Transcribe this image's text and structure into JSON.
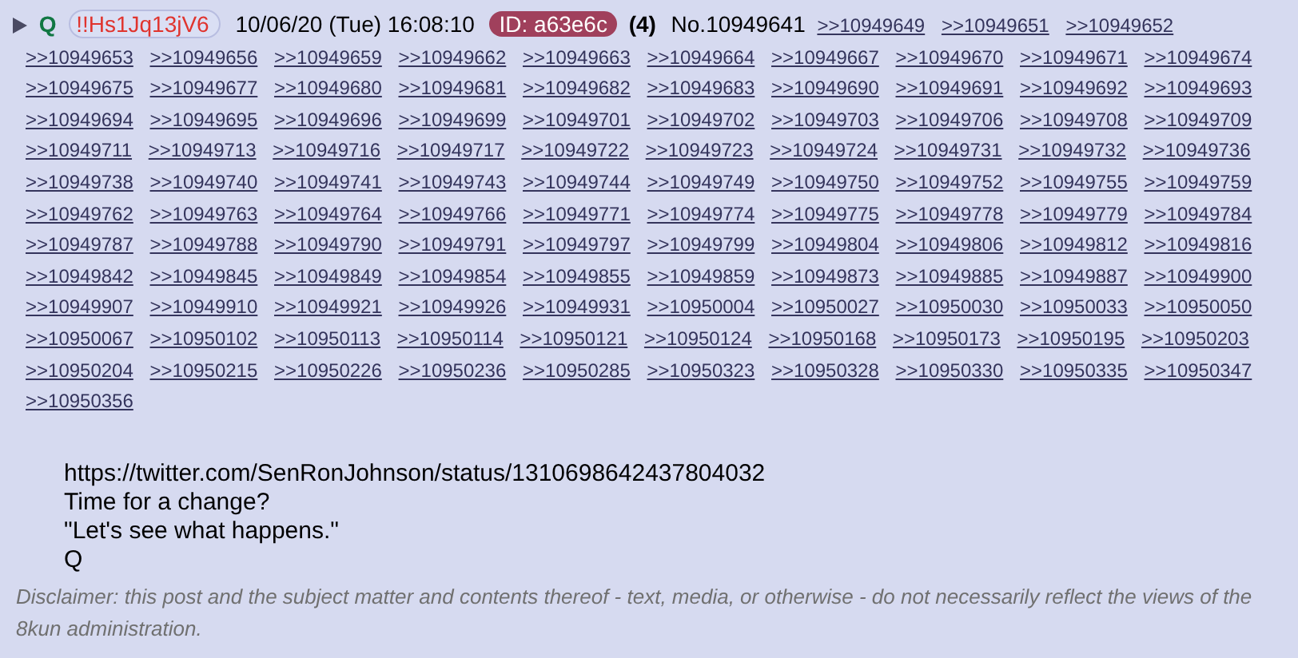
{
  "post": {
    "name": "Q",
    "tripcode": "!!Hs1Jq13jV6",
    "date": "10/06/20 (Tue) 16:08:10",
    "poster_id": "ID: a63e6c",
    "reply_count": "(4)",
    "post_number": "No.10949641",
    "backlinks": [
      ">>10949649",
      ">>10949651",
      ">>10949652",
      ">>10949653",
      ">>10949656",
      ">>10949659",
      ">>10949662",
      ">>10949663",
      ">>10949664",
      ">>10949667",
      ">>10949670",
      ">>10949671",
      ">>10949674",
      ">>10949675",
      ">>10949677",
      ">>10949680",
      ">>10949681",
      ">>10949682",
      ">>10949683",
      ">>10949690",
      ">>10949691",
      ">>10949692",
      ">>10949693",
      ">>10949694",
      ">>10949695",
      ">>10949696",
      ">>10949699",
      ">>10949701",
      ">>10949702",
      ">>10949703",
      ">>10949706",
      ">>10949708",
      ">>10949709",
      ">>10949711",
      ">>10949713",
      ">>10949716",
      ">>10949717",
      ">>10949722",
      ">>10949723",
      ">>10949724",
      ">>10949731",
      ">>10949732",
      ">>10949736",
      ">>10949738",
      ">>10949740",
      ">>10949741",
      ">>10949743",
      ">>10949744",
      ">>10949749",
      ">>10949750",
      ">>10949752",
      ">>10949755",
      ">>10949759",
      ">>10949762",
      ">>10949763",
      ">>10949764",
      ">>10949766",
      ">>10949771",
      ">>10949774",
      ">>10949775",
      ">>10949778",
      ">>10949779",
      ">>10949784",
      ">>10949787",
      ">>10949788",
      ">>10949790",
      ">>10949791",
      ">>10949797",
      ">>10949799",
      ">>10949804",
      ">>10949806",
      ">>10949812",
      ">>10949816",
      ">>10949842",
      ">>10949845",
      ">>10949849",
      ">>10949854",
      ">>10949855",
      ">>10949859",
      ">>10949873",
      ">>10949885",
      ">>10949887",
      ">>10949900",
      ">>10949907",
      ">>10949910",
      ">>10949921",
      ">>10949926",
      ">>10949931",
      ">>10950004",
      ">>10950027",
      ">>10950030",
      ">>10950033",
      ">>10950050",
      ">>10950067",
      ">>10950102",
      ">>10950113",
      ">>10950114",
      ">>10950121",
      ">>10950124",
      ">>10950168",
      ">>10950173",
      ">>10950195",
      ">>10950203",
      ">>10950204",
      ">>10950215",
      ">>10950226",
      ">>10950236",
      ">>10950285",
      ">>10950323",
      ">>10950328",
      ">>10950330",
      ">>10950335",
      ">>10950347",
      ">>10950356"
    ],
    "body": [
      "https://twitter.com/SenRonJohnson/status/1310698642437804032",
      "Time for a change?",
      "\"Let's see what happens.\"",
      "Q"
    ],
    "disclaimer": "Disclaimer: this post and the subject matter and contents thereof - text, media, or otherwise - do not necessarily reflect the views of the 8kun administration."
  }
}
